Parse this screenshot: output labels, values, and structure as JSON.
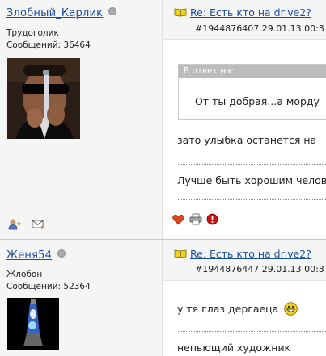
{
  "posts": [
    {
      "username": "Злобный_Карлик",
      "rank": "Трудоголик",
      "posts_count": "Сообщений: 36464",
      "title": "Re: Есть кто на drive2?",
      "meta": "#1944876407 29.01.13 00:3",
      "quote_header": "В ответ на:",
      "quote_text": "От ты добрая...а морду",
      "line1": "зато улыбка останется на",
      "line2": "Лучше быть хорошим челов"
    },
    {
      "username": "Женя54",
      "rank": "Жлобон",
      "posts_count": "Сообщений: 52364",
      "title": "Re: Есть кто на drive2?",
      "meta": "#1944876447 29.01.13 00:3",
      "line1": "у тя глаз дергаеца",
      "line2": "непьющий художник"
    }
  ],
  "icons": {
    "status": "offline-dot-icon",
    "title": "open-book-icon",
    "actions": [
      "add-friend-icon",
      "send-message-icon"
    ],
    "post_tools": [
      "heart-icon",
      "print-icon",
      "report-icon"
    ],
    "smiley": "grin-emoticon-icon"
  },
  "colors": {
    "link": "#1a4f9c",
    "user_panel": "#f5f5f5",
    "quote_header": "#bcbcbc",
    "heart": "#d94a1e",
    "report": "#cc1111",
    "book": "#e6c60a"
  }
}
